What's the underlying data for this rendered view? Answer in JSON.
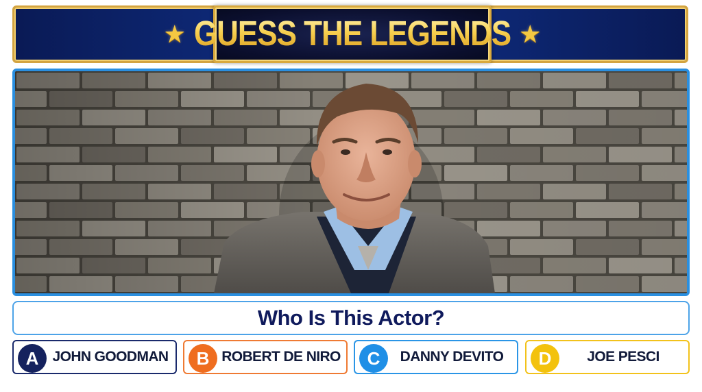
{
  "header": {
    "title": "GUESS THE LEGENDS",
    "star_left": "★",
    "star_right": "★"
  },
  "photo": {
    "subject": "actor-portrait"
  },
  "question": {
    "text": "Who Is This Actor?"
  },
  "answers": [
    {
      "letter": "A",
      "label": "JOHN GOODMAN",
      "color": "#15225e"
    },
    {
      "letter": "B",
      "label": "ROBERT DE NIRO",
      "color": "#ef6d1f"
    },
    {
      "letter": "C",
      "label": "DANNY DEVITO",
      "color": "#1f8fe6"
    },
    {
      "letter": "D",
      "label": "JOE PESCI",
      "color": "#f3c20d"
    }
  ],
  "colors": {
    "banner_blue": "#0e2a7a",
    "gold": "#f4c842",
    "frame_blue": "#2a8fe0",
    "question_text": "#0f1a5c"
  }
}
